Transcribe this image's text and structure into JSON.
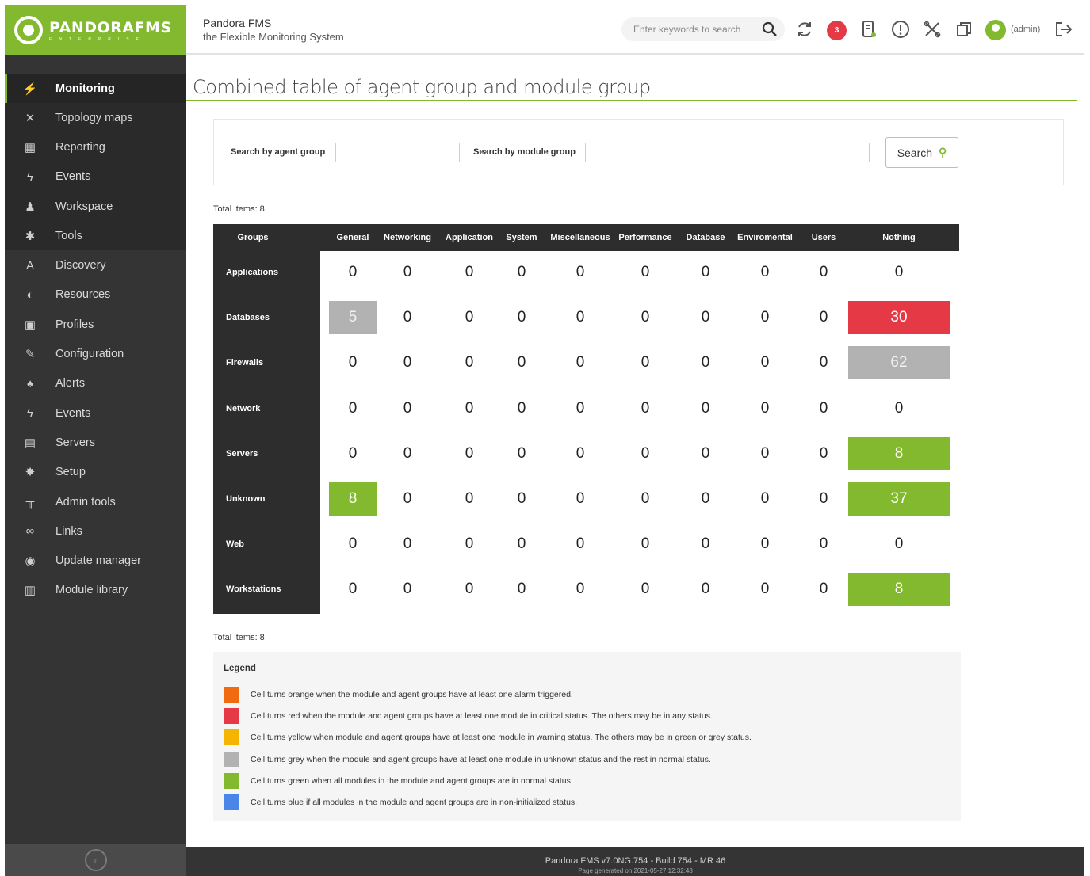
{
  "app": {
    "logo_name": "PANDORAFMS",
    "logo_sub": "ENTERPRISE",
    "title": "Pandora FMS",
    "subtitle": "the Flexible Monitoring System"
  },
  "header": {
    "search_placeholder": "Enter keywords to search",
    "notifications_count": "3",
    "user": "(admin)"
  },
  "sidebar": {
    "items": [
      {
        "label": "Monitoring",
        "icon": "monitoring-icon",
        "glyph": "⚡"
      },
      {
        "label": "Topology maps",
        "icon": "topology-icon",
        "glyph": "✕"
      },
      {
        "label": "Reporting",
        "icon": "reporting-icon",
        "glyph": "▦"
      },
      {
        "label": "Events",
        "icon": "events-icon",
        "glyph": "ϟ"
      },
      {
        "label": "Workspace",
        "icon": "workspace-icon",
        "glyph": "♟"
      },
      {
        "label": "Tools",
        "icon": "tools-icon",
        "glyph": "✱"
      },
      {
        "label": "Discovery",
        "icon": "discovery-icon",
        "glyph": "A"
      },
      {
        "label": "Resources",
        "icon": "resources-icon",
        "glyph": "◐"
      },
      {
        "label": "Profiles",
        "icon": "profiles-icon",
        "glyph": "▣"
      },
      {
        "label": "Configuration",
        "icon": "configuration-icon",
        "glyph": "✎"
      },
      {
        "label": "Alerts",
        "icon": "alerts-icon",
        "glyph": "♠"
      },
      {
        "label": "Events",
        "icon": "events-admin-icon",
        "glyph": "ϟ"
      },
      {
        "label": "Servers",
        "icon": "servers-icon",
        "glyph": "▤"
      },
      {
        "label": "Setup",
        "icon": "setup-icon",
        "glyph": "✸"
      },
      {
        "label": "Admin tools",
        "icon": "admin-tools-icon",
        "glyph": "╥"
      },
      {
        "label": "Links",
        "icon": "links-icon",
        "glyph": "∞"
      },
      {
        "label": "Update manager",
        "icon": "update-manager-icon",
        "glyph": "◉"
      },
      {
        "label": "Module library",
        "icon": "module-library-icon",
        "glyph": "▥"
      }
    ]
  },
  "page": {
    "title": "Combined table of agent group and module group"
  },
  "filters": {
    "agent_group_label": "Search by agent group",
    "agent_group_value": "",
    "module_group_label": "Search by module group",
    "module_group_value": "",
    "search_button": "Search"
  },
  "table": {
    "total_top": "Total items: 8",
    "total_bottom": "Total items: 8",
    "groups_header": "Groups",
    "columns": [
      "General",
      "Networking",
      "Application",
      "System",
      "Miscellaneous",
      "Performance",
      "Database",
      "Enviromental",
      "Users",
      "Nothing"
    ],
    "rows": [
      {
        "label": "Applications",
        "values": [
          "0",
          "0",
          "0",
          "0",
          "0",
          "0",
          "0",
          "0",
          "0",
          "0"
        ],
        "status": [
          "",
          "",
          "",
          "",
          "",
          "",
          "",
          "",
          "",
          ""
        ]
      },
      {
        "label": "Databases",
        "values": [
          "5",
          "0",
          "0",
          "0",
          "0",
          "0",
          "0",
          "0",
          "0",
          "30"
        ],
        "status": [
          "grey",
          "",
          "",
          "",
          "",
          "",
          "",
          "",
          "",
          "red"
        ]
      },
      {
        "label": "Firewalls",
        "values": [
          "0",
          "0",
          "0",
          "0",
          "0",
          "0",
          "0",
          "0",
          "0",
          "62"
        ],
        "status": [
          "",
          "",
          "",
          "",
          "",
          "",
          "",
          "",
          "",
          "grey"
        ]
      },
      {
        "label": "Network",
        "values": [
          "0",
          "0",
          "0",
          "0",
          "0",
          "0",
          "0",
          "0",
          "0",
          "0"
        ],
        "status": [
          "",
          "",
          "",
          "",
          "",
          "",
          "",
          "",
          "",
          ""
        ]
      },
      {
        "label": "Servers",
        "values": [
          "0",
          "0",
          "0",
          "0",
          "0",
          "0",
          "0",
          "0",
          "0",
          "8"
        ],
        "status": [
          "",
          "",
          "",
          "",
          "",
          "",
          "",
          "",
          "",
          "green"
        ]
      },
      {
        "label": "Unknown",
        "values": [
          "8",
          "0",
          "0",
          "0",
          "0",
          "0",
          "0",
          "0",
          "0",
          "37"
        ],
        "status": [
          "green",
          "",
          "",
          "",
          "",
          "",
          "",
          "",
          "",
          "green"
        ]
      },
      {
        "label": "Web",
        "values": [
          "0",
          "0",
          "0",
          "0",
          "0",
          "0",
          "0",
          "0",
          "0",
          "0"
        ],
        "status": [
          "",
          "",
          "",
          "",
          "",
          "",
          "",
          "",
          "",
          ""
        ]
      },
      {
        "label": "Workstations",
        "values": [
          "0",
          "0",
          "0",
          "0",
          "0",
          "0",
          "0",
          "0",
          "0",
          "8"
        ],
        "status": [
          "",
          "",
          "",
          "",
          "",
          "",
          "",
          "",
          "",
          "green"
        ]
      }
    ]
  },
  "legend": {
    "title": "Legend",
    "items": [
      {
        "color": "#f26a0f",
        "text": "Cell turns orange when the module and agent groups have at least one alarm triggered."
      },
      {
        "color": "#e63946",
        "text": "Cell turns red when the module and agent groups have at least one module in critical status. The others may be in any status."
      },
      {
        "color": "#f5b400",
        "text": "Cell turns yellow when module and agent groups have at least one module in warning status. The others may be in green or grey status."
      },
      {
        "color": "#b2b2b2",
        "text": "Cell turns grey when the module and agent groups have at least one module in unknown status and the rest in normal status."
      },
      {
        "color": "#82b92e",
        "text": "Cell turns green when all modules in the module and agent groups are in normal status."
      },
      {
        "color": "#4a86e8",
        "text": "Cell turns blue if all modules in the module and agent groups are in non-initialized status."
      }
    ]
  },
  "footer": {
    "version": "Pandora FMS v7.0NG.754 - Build 754 - MR 46",
    "generated": "Page generated on 2021-05-27 12:32:48"
  }
}
